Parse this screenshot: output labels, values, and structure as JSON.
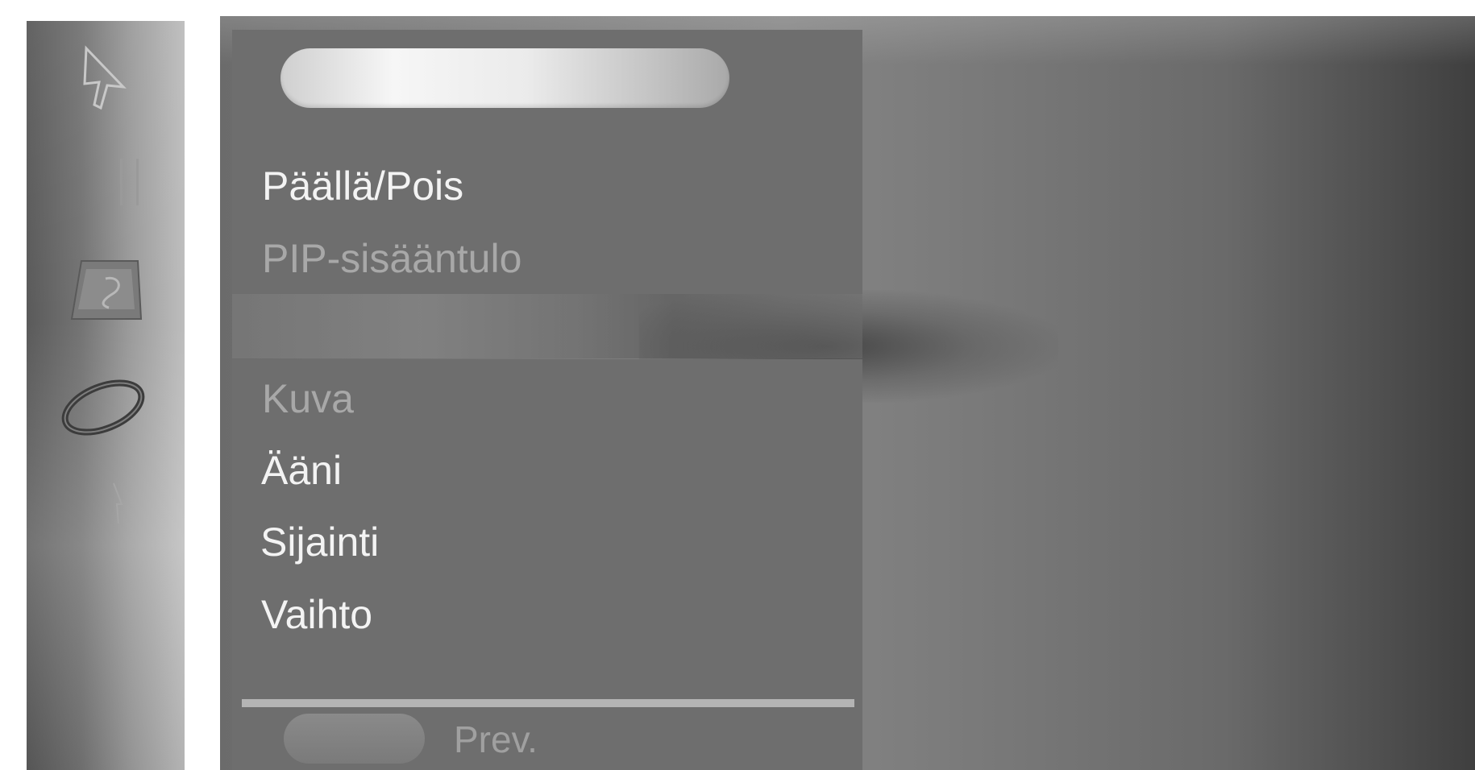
{
  "sidebar": {
    "icons": [
      "cursor-arrow-icon",
      "bars-icon",
      "scroll-paper-icon",
      "ring-disc-icon",
      "small-arrow-icon"
    ]
  },
  "top_panel": {
    "title_pill": "",
    "items": [
      {
        "label": "Päällä/Pois",
        "state": "enabled"
      },
      {
        "label": "PIP-sisääntulo",
        "state": "disabled"
      }
    ]
  },
  "bottom_panel": {
    "items": [
      {
        "label": "Kuva",
        "state": "disabled"
      },
      {
        "label": "Ääni",
        "state": "enabled"
      },
      {
        "label": "Sijainti",
        "state": "enabled"
      },
      {
        "label": "Vaihto",
        "state": "enabled"
      }
    ],
    "prev_label": "Prev."
  },
  "colors": {
    "panel": "#6e6e6e",
    "text_enabled": "#f3f3f3",
    "text_disabled": "#a8a8a8",
    "pill_highlight": "#f6f6f6"
  }
}
